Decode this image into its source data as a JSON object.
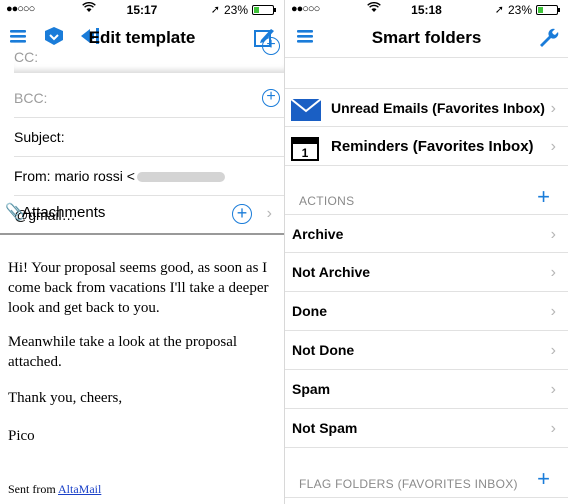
{
  "left": {
    "status": {
      "signal": "●●○○○",
      "time": "15:17",
      "battery": "23%",
      "battery_level": 0.23
    },
    "nav": {
      "title": "Edit template"
    },
    "fields": {
      "cc_label": "CC:",
      "bcc_label": "BCC:",
      "subject_label": "Subject:",
      "from_label": "From:",
      "from_name": "mario rossi <",
      "from_domain": "@gmail…"
    },
    "attachments_label": "Attachments",
    "body": {
      "p1": "Hi! Your proposal seems good, as soon as I come back from vacations I'll take a deeper look and get back to you.",
      "p2": "Meanwhile take a look at the proposal attached.",
      "p3": "Thank you, cheers,",
      "p4": "Pico"
    },
    "signature": {
      "prefix": "Sent from ",
      "link": "AltaMail"
    }
  },
  "right": {
    "status": {
      "signal": "●●○○○",
      "time": "15:18",
      "battery": "23%",
      "battery_level": 0.23
    },
    "nav": {
      "title": "Smart folders"
    },
    "folders": [
      {
        "label": "Unread Emails (Favorites Inbox)",
        "icon": "envelope-icon"
      },
      {
        "label": "Reminders (Favorites Inbox)",
        "icon": "calendar-icon"
      }
    ],
    "actions_header": "ACTIONS",
    "actions": [
      "Archive",
      "Not Archive",
      "Done",
      "Not Done",
      "Spam",
      "Not Spam"
    ],
    "flag_header": "FLAG FOLDERS (FAVORITES INBOX)"
  },
  "colors": {
    "accent": "#1a7cd9",
    "battery": "#3fc33a"
  }
}
